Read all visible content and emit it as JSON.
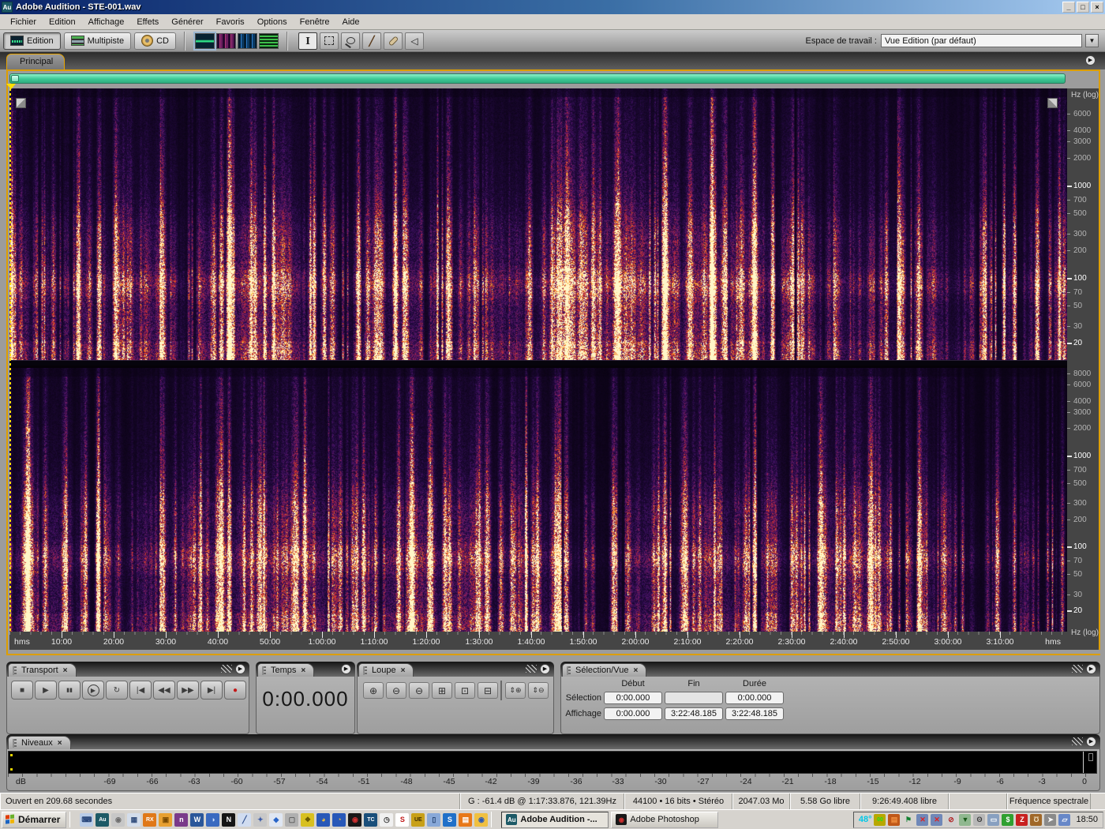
{
  "window": {
    "app_badge": "Au",
    "title": "Adobe Audition - STE-001.wav",
    "controls": {
      "minimize": "_",
      "restore": "□",
      "close": "×"
    }
  },
  "menu": [
    "Fichier",
    "Edition",
    "Affichage",
    "Effets",
    "Générer",
    "Favoris",
    "Options",
    "Fenêtre",
    "Aide"
  ],
  "toolbar": {
    "mode_buttons": [
      {
        "name": "edition-mode-button",
        "label": "Edition",
        "active": true
      },
      {
        "name": "multipiste-mode-button",
        "label": "Multipiste",
        "active": false
      },
      {
        "name": "cd-mode-button",
        "label": "CD",
        "active": false
      }
    ],
    "workspace": {
      "label": "Espace de travail :",
      "value": "Vue Edition (par défaut)",
      "arrow": "▼"
    }
  },
  "tabs": {
    "main": "Principal",
    "menu_glyph": "▶"
  },
  "spectral": {
    "axis_label": "Hz (log)",
    "ch1_ticks": [
      6000,
      4000,
      3000,
      2000,
      1000,
      700,
      500,
      300,
      200,
      100,
      70,
      50,
      30,
      20
    ],
    "ch2_ticks": [
      8000,
      6000,
      4000,
      3000,
      2000,
      1000,
      700,
      500,
      300,
      200,
      100,
      70,
      50,
      30,
      20
    ],
    "major_ticks": [
      1000,
      100,
      20
    ]
  },
  "timeline": {
    "unit_left": "hms",
    "unit_right": "hms",
    "labels": [
      "10:00",
      "20:00",
      "30:00",
      "40:00",
      "50:00",
      "1:00:00",
      "1:10:00",
      "1:20:00",
      "1:30:00",
      "1:40:00",
      "1:50:00",
      "2:00:00",
      "2:10:00",
      "2:20:00",
      "2:30:00",
      "2:40:00",
      "2:50:00",
      "3:00:00",
      "3:10:00"
    ]
  },
  "transport": {
    "title": "Transport",
    "close": "×",
    "buttons": [
      {
        "name": "stop-button",
        "glyph": "■"
      },
      {
        "name": "play-button",
        "glyph": "▶"
      },
      {
        "name": "pause-button",
        "glyph": "▮▮"
      },
      {
        "name": "play-spool-button",
        "glyph": "▶",
        "circle": true
      },
      {
        "name": "loop-play-button",
        "glyph": "↻"
      },
      {
        "name": "go-to-start-button",
        "glyph": "|◀"
      },
      {
        "name": "rewind-button",
        "glyph": "◀◀"
      },
      {
        "name": "fast-forward-button",
        "glyph": "▶▶"
      },
      {
        "name": "go-to-end-button",
        "glyph": "▶|"
      },
      {
        "name": "record-button",
        "glyph": "●",
        "color": "#c41818"
      }
    ]
  },
  "temps": {
    "title": "Temps",
    "close": "×",
    "value": "0:00.000"
  },
  "loupe": {
    "title": "Loupe",
    "close": "×",
    "buttons": [
      {
        "name": "zoom-in-horizontal-button",
        "glyph": "⊕"
      },
      {
        "name": "zoom-out-horizontal-button",
        "glyph": "⊖"
      },
      {
        "name": "zoom-out-full-button",
        "glyph": "⊖"
      },
      {
        "name": "zoom-selection-left-button",
        "glyph": "⊞"
      },
      {
        "name": "zoom-to-selection-button",
        "glyph": "⊡"
      },
      {
        "name": "zoom-selection-right-button",
        "glyph": "⊟"
      },
      {
        "name": "divider"
      },
      {
        "name": "zoom-in-vertical-button",
        "glyph": "⇕⊕"
      },
      {
        "name": "zoom-out-vertical-button",
        "glyph": "⇕⊖"
      }
    ]
  },
  "selection_vue": {
    "title": "Sélection/Vue",
    "close": "×",
    "columns": [
      "Début",
      "Fin",
      "Durée"
    ],
    "rows": [
      {
        "label": "Sélection",
        "debut": "0:00.000",
        "fin": "",
        "duree": "0:00.000"
      },
      {
        "label": "Affichage",
        "debut": "0:00.000",
        "fin": "3:22:48.185",
        "duree": "3:22:48.185"
      }
    ]
  },
  "niveaux": {
    "title": "Niveaux",
    "close": "×",
    "unit": "dB",
    "db_min": -69,
    "db_max": 0,
    "db_step": 3
  },
  "status": {
    "items": [
      "Ouvert en 209.68 secondes",
      "G : -61.4 dB @ 1:17:33.876, 121.39Hz",
      "44100 • 16 bits • Stéréo",
      "2047.03 Mo",
      "5.58 Go libre",
      "9:26:49.408 libre",
      "",
      "Fréquence spectrale"
    ]
  },
  "taskbar": {
    "start": "Démarrer",
    "quick_launch": [
      {
        "name": "media-keyboard-icon",
        "glyph": "⌨",
        "bg": "#b9cce8",
        "fg": "#27457a"
      },
      {
        "name": "audition-quicklaunch-icon",
        "glyph": "Au",
        "bg": "#1d5a66",
        "fg": "#ffffff"
      },
      {
        "name": "sphere-app-icon",
        "glyph": "◉",
        "bg": "#c7c7c7",
        "fg": "#6e6e6e"
      },
      {
        "name": "calculator-app-icon",
        "glyph": "▦",
        "bg": "#d3ddeb",
        "fg": "#35507e"
      },
      {
        "name": "rx-app-icon",
        "glyph": "RX",
        "bg": "#e07818",
        "fg": "#ffffff"
      },
      {
        "name": "office-folder-icon",
        "glyph": "▣",
        "bg": "#e8a030",
        "fg": "#7a4a00"
      },
      {
        "name": "onenote-icon",
        "glyph": "n",
        "bg": "#7a3a8a",
        "fg": "#ffffff"
      },
      {
        "name": "word-icon",
        "glyph": "W",
        "bg": "#2b579a",
        "fg": "#ffffff"
      },
      {
        "name": "planet-browser-icon",
        "glyph": "◑",
        "bg": "#3a6ac0",
        "fg": "#cfe0ff"
      },
      {
        "name": "n-black-app-icon",
        "glyph": "N",
        "bg": "#151515",
        "fg": "#ffffff"
      },
      {
        "name": "magic-wand-icon",
        "glyph": "╱",
        "bg": "#d0dcf0",
        "fg": "#2a4a8a"
      },
      {
        "name": "star-burst-icon",
        "glyph": "✦",
        "bg": "#c8c8c8",
        "fg": "#3a5aa8"
      },
      {
        "name": "blue-diamond-icon",
        "glyph": "◆",
        "bg": "#dfe6f2",
        "fg": "#2864c8"
      },
      {
        "name": "gray-app-icon",
        "glyph": "▢",
        "bg": "#b0b0b0",
        "fg": "#5a5a5a"
      },
      {
        "name": "yellow-tool-icon",
        "glyph": "❖",
        "bg": "#d8c020",
        "fg": "#6a5a00"
      },
      {
        "name": "globe-gold-icon",
        "glyph": "◕",
        "bg": "#2858b8",
        "fg": "#f0c040"
      },
      {
        "name": "globe-gold2-icon",
        "glyph": "◔",
        "bg": "#2858b8",
        "fg": "#f0c040"
      },
      {
        "name": "photoshop-eye-icon",
        "glyph": "◉",
        "bg": "#181818",
        "fg": "#d03030"
      },
      {
        "name": "tc-circle-icon",
        "glyph": "TC",
        "bg": "#1a4f7a",
        "fg": "#ffffff"
      },
      {
        "name": "clock-app-icon",
        "glyph": "◷",
        "bg": "#f0f0f0",
        "fg": "#333333"
      },
      {
        "name": "sbp-icon",
        "glyph": "S",
        "bg": "#ffffff",
        "fg": "#c01818"
      },
      {
        "name": "ue-coin-icon",
        "glyph": "UE",
        "bg": "#c8a018",
        "fg": "#3a2a00"
      },
      {
        "name": "blue-device-icon",
        "glyph": "▯",
        "bg": "#88a8d8",
        "fg": "#23406e"
      },
      {
        "name": "s-swish-icon",
        "glyph": "S",
        "bg": "#2070c8",
        "fg": "#ffffff"
      },
      {
        "name": "pdf-icon",
        "glyph": "▤",
        "bg": "#e87818",
        "fg": "#ffffff"
      },
      {
        "name": "media-player-icon",
        "glyph": "◉",
        "bg": "#f0c040",
        "fg": "#2858b8"
      }
    ],
    "windows": [
      {
        "name": "taskbar-window-audition",
        "icon": "Au",
        "icon_bg": "#1d5a66",
        "icon_fg": "#ffffff",
        "label": "Adobe Audition -...",
        "active": true
      },
      {
        "name": "taskbar-window-photoshop",
        "icon": "◉",
        "icon_bg": "#181818",
        "icon_fg": "#d03030",
        "label": "Adobe Photoshop",
        "active": false
      }
    ],
    "tray_icons": [
      {
        "name": "level-meter-tray-icon",
        "glyph": "00",
        "bg": "#b8a800",
        "fg": "#20e020"
      },
      {
        "name": "stacked-bars-tray-icon",
        "glyph": "▤",
        "bg": "#c05818",
        "fg": "#f09040"
      },
      {
        "name": "green-flag-tray-icon",
        "glyph": "⚑",
        "bg": "#d6d3ce",
        "fg": "#108030"
      },
      {
        "name": "network-disabled-tray-icon",
        "glyph": "✕",
        "bg": "#7088b8",
        "fg": "#e02020"
      },
      {
        "name": "network-disabled2-tray-icon",
        "glyph": "✕",
        "bg": "#7088b8",
        "fg": "#e02020"
      },
      {
        "name": "blocked-tray-icon",
        "glyph": "⊘",
        "bg": "#d0d0d0",
        "fg": "#b02020"
      },
      {
        "name": "updates-tray-icon",
        "glyph": "▼",
        "bg": "#90b890",
        "fg": "#1a5a1a"
      },
      {
        "name": "mouse-tray-icon",
        "glyph": "ʘ",
        "bg": "#b8b8b8",
        "fg": "#3a3a3a"
      },
      {
        "name": "display-tray-icon",
        "glyph": "▭",
        "bg": "#88a0c0",
        "fg": "#ffffff"
      },
      {
        "name": "money-tray-icon",
        "glyph": "$",
        "bg": "#30a030",
        "fg": "#ffffff"
      },
      {
        "name": "lightning-tray-icon",
        "glyph": "Z",
        "bg": "#c82020",
        "fg": "#ffffff"
      },
      {
        "name": "jug-tray-icon",
        "glyph": "Ʊ",
        "bg": "#a06828",
        "fg": "#f0e0c0"
      },
      {
        "name": "cursor-tray-icon",
        "glyph": "➤",
        "bg": "#8a8a8a",
        "fg": "#f8f8f8"
      },
      {
        "name": "folder-tray-icon",
        "glyph": "▱",
        "bg": "#6888c8",
        "fg": "#ffffff"
      }
    ],
    "tray_temp": "48°",
    "clock": "18:50"
  },
  "colors": {
    "accent_orange": "#e8a400",
    "playhead_yellow": "#ffe000",
    "nav_green": "#3cc894",
    "record_red": "#c41818",
    "tray_temp_color": "#00c8e8"
  }
}
